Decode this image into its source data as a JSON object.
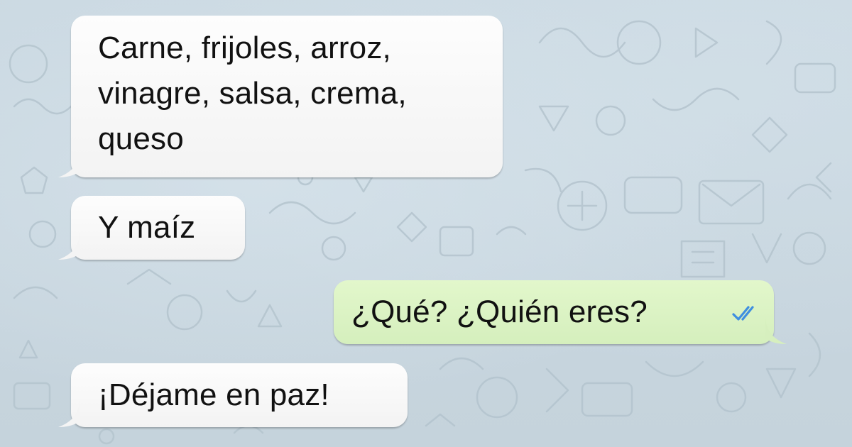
{
  "chat": {
    "messages": [
      {
        "direction": "incoming",
        "text": "Carne, frijoles, arroz,\nvinagre, salsa, crema,\nqueso"
      },
      {
        "direction": "incoming",
        "text": "Y maíz"
      },
      {
        "direction": "outgoing",
        "text": "¿Qué? ¿Quién eres?",
        "status_icon": "double-check-icon",
        "status_color": "#3f8fe0"
      },
      {
        "direction": "incoming",
        "text": "¡Déjame en paz!"
      }
    ]
  },
  "colors": {
    "background": "#c8d6df",
    "incoming_bubble": "#f7f7f7",
    "outgoing_bubble": "#dcf4c4",
    "read_receipt": "#3f8fe0"
  }
}
